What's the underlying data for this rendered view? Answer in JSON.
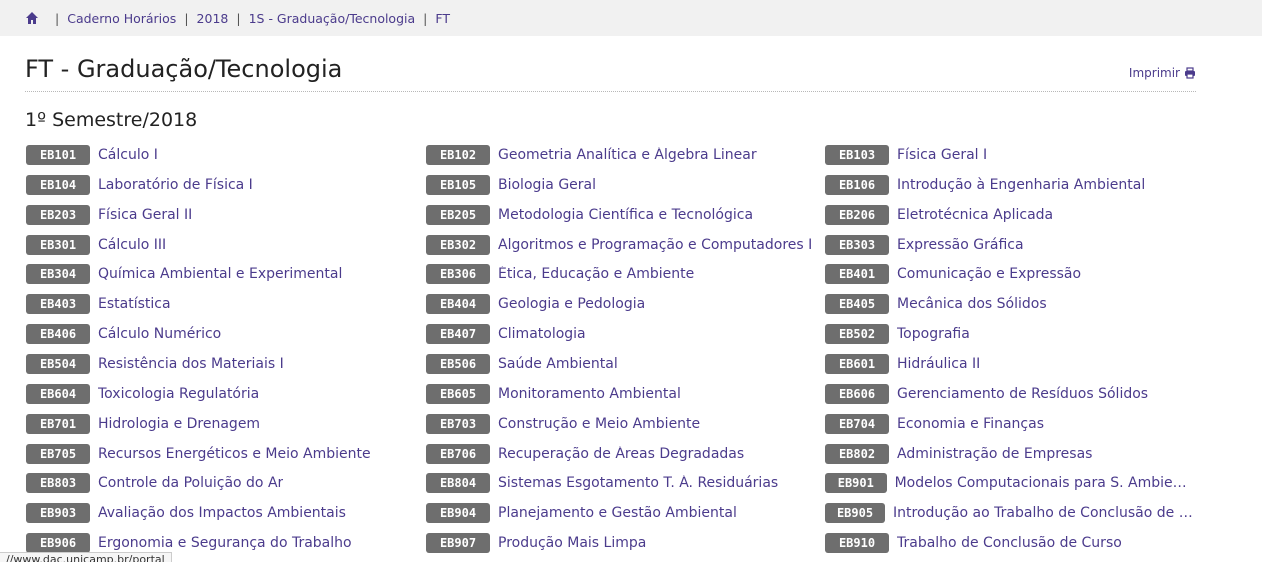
{
  "breadcrumb": {
    "items": [
      "Caderno Horários",
      "2018",
      "1S - Graduação/Tecnologia",
      "FT"
    ]
  },
  "header": {
    "title": "FT - Graduação/Tecnologia",
    "print_label": "Imprimir"
  },
  "semester_title": "1º Semestre/2018",
  "courses": [
    [
      {
        "code": "EB101",
        "name": "Cálculo I"
      },
      {
        "code": "EB102",
        "name": "Geometria Analítica e Álgebra Linear"
      },
      {
        "code": "EB103",
        "name": "Física Geral I"
      }
    ],
    [
      {
        "code": "EB104",
        "name": "Laboratório de Física I"
      },
      {
        "code": "EB105",
        "name": "Biologia Geral"
      },
      {
        "code": "EB106",
        "name": "Introdução à Engenharia Ambiental"
      }
    ],
    [
      {
        "code": "EB203",
        "name": "Física Geral II"
      },
      {
        "code": "EB205",
        "name": "Metodologia Científica e Tecnológica"
      },
      {
        "code": "EB206",
        "name": "Eletrotécnica Aplicada"
      }
    ],
    [
      {
        "code": "EB301",
        "name": "Cálculo III"
      },
      {
        "code": "EB302",
        "name": "Algoritmos e Programação e Computadores I"
      },
      {
        "code": "EB303",
        "name": "Expressão Gráfica"
      }
    ],
    [
      {
        "code": "EB304",
        "name": "Química Ambiental e Experimental"
      },
      {
        "code": "EB306",
        "name": "Ética, Educação e Ambiente"
      },
      {
        "code": "EB401",
        "name": "Comunicação e Expressão"
      }
    ],
    [
      {
        "code": "EB403",
        "name": "Estatística"
      },
      {
        "code": "EB404",
        "name": "Geologia e Pedologia"
      },
      {
        "code": "EB405",
        "name": "Mecânica dos Sólidos"
      }
    ],
    [
      {
        "code": "EB406",
        "name": "Cálculo Numérico"
      },
      {
        "code": "EB407",
        "name": "Climatologia"
      },
      {
        "code": "EB502",
        "name": "Topografia"
      }
    ],
    [
      {
        "code": "EB504",
        "name": "Resistência dos Materiais I"
      },
      {
        "code": "EB506",
        "name": "Saúde Ambiental"
      },
      {
        "code": "EB601",
        "name": "Hidráulica II"
      }
    ],
    [
      {
        "code": "EB604",
        "name": "Toxicologia Regulatória"
      },
      {
        "code": "EB605",
        "name": "Monitoramento Ambiental"
      },
      {
        "code": "EB606",
        "name": "Gerenciamento de Resíduos Sólidos"
      }
    ],
    [
      {
        "code": "EB701",
        "name": "Hidrologia e Drenagem"
      },
      {
        "code": "EB703",
        "name": "Construção e Meio Ambiente"
      },
      {
        "code": "EB704",
        "name": "Economia e Finanças"
      }
    ],
    [
      {
        "code": "EB705",
        "name": "Recursos Energéticos e Meio Ambiente"
      },
      {
        "code": "EB706",
        "name": "Recuperação de Áreas Degradadas"
      },
      {
        "code": "EB802",
        "name": "Administração de Empresas"
      }
    ],
    [
      {
        "code": "EB803",
        "name": "Controle da Poluição do Ar"
      },
      {
        "code": "EB804",
        "name": "Sistemas Esgotamento T. Á. Residuárias"
      },
      {
        "code": "EB901",
        "name": "Modelos Computacionais para S. Ambientais"
      }
    ],
    [
      {
        "code": "EB903",
        "name": "Avaliação dos Impactos Ambientais"
      },
      {
        "code": "EB904",
        "name": "Planejamento e Gestão Ambiental"
      },
      {
        "code": "EB905",
        "name": "Introdução ao Trabalho de Conclusão de Cur..."
      }
    ],
    [
      {
        "code": "EB906",
        "name": "Ergonomia e Segurança do Trabalho"
      },
      {
        "code": "EB907",
        "name": "Produção Mais Limpa"
      },
      {
        "code": "EB910",
        "name": "Trabalho de Conclusão de Curso"
      }
    ]
  ],
  "status_bar": {
    "text": "//www.dac.unicamp.br/portal"
  },
  "colors": {
    "link": "#4b3b8c",
    "badge": "#6e6e6e",
    "breadcrumb_bg": "#f1f1f1"
  },
  "icons": {
    "home": "home-icon",
    "print": "printer-icon"
  }
}
